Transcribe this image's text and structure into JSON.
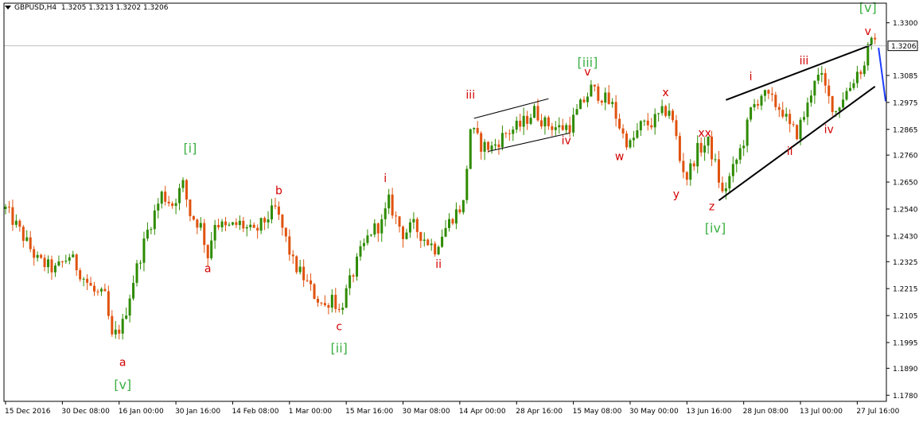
{
  "header": {
    "symbol": "GBPUSD,H4",
    "ohlc": "1.3205 1.3213 1.3202 1.3206"
  },
  "chart_data": {
    "type": "candlestick",
    "symbol": "GBPUSD",
    "timeframe": "H4",
    "ohlc_last": {
      "open": 1.3205,
      "high": 1.3213,
      "low": 1.3202,
      "close": 1.3206
    },
    "current_price_label": "1.3206",
    "current_price": 1.3206,
    "ylim": [
      1.1755,
      1.338
    ],
    "y_ticks": [
      "1.3300",
      "1.3085",
      "1.2975",
      "1.2865",
      "1.2760",
      "1.2650",
      "1.2540",
      "1.2430",
      "1.2325",
      "1.2215",
      "1.2105",
      "1.1995",
      "1.1890",
      "1.1780"
    ],
    "x_ticks": [
      "15 Dec 2016",
      "30 Dec 08:00",
      "16 Jan 00:00",
      "30 Jan 16:00",
      "14 Feb 08:00",
      "1 Mar 00:00",
      "15 Mar 16:00",
      "30 Mar 08:00",
      "14 Apr 00:00",
      "28 Apr 16:00",
      "15 May 08:00",
      "30 May 00:00",
      "13 Jun 16:00",
      "28 Jun 08:00",
      "13 Jul 00:00",
      "27 Jul 16:00"
    ],
    "x_tick_index": [
      0,
      16,
      32,
      48,
      64,
      80,
      96,
      112,
      128,
      144,
      160,
      176,
      192,
      208,
      224,
      240
    ],
    "bar_count": 246,
    "price_path": [
      [
        0,
        1.254
      ],
      [
        4,
        1.245
      ],
      [
        9,
        1.233
      ],
      [
        14,
        1.229
      ],
      [
        18,
        1.235
      ],
      [
        22,
        1.226
      ],
      [
        25,
        1.22
      ],
      [
        28,
        1.218
      ],
      [
        30,
        1.201
      ],
      [
        33,
        1.207
      ],
      [
        36,
        1.225
      ],
      [
        40,
        1.245
      ],
      [
        44,
        1.26
      ],
      [
        47,
        1.256
      ],
      [
        50,
        1.264
      ],
      [
        52,
        1.252
      ],
      [
        55,
        1.247
      ],
      [
        57,
        1.235
      ],
      [
        59,
        1.249
      ],
      [
        62,
        1.246
      ],
      [
        66,
        1.248
      ],
      [
        70,
        1.244
      ],
      [
        74,
        1.251
      ],
      [
        76,
        1.254
      ],
      [
        78,
        1.246
      ],
      [
        81,
        1.232
      ],
      [
        84,
        1.226
      ],
      [
        87,
        1.219
      ],
      [
        90,
        1.214
      ],
      [
        92,
        1.219
      ],
      [
        94,
        1.212
      ],
      [
        97,
        1.224
      ],
      [
        100,
        1.236
      ],
      [
        103,
        1.245
      ],
      [
        106,
        1.248
      ],
      [
        108,
        1.257
      ],
      [
        110,
        1.25
      ],
      [
        112,
        1.244
      ],
      [
        115,
        1.247
      ],
      [
        118,
        1.242
      ],
      [
        121,
        1.238
      ],
      [
        123,
        1.244
      ],
      [
        126,
        1.251
      ],
      [
        129,
        1.256
      ],
      [
        131,
        1.287
      ],
      [
        134,
        1.28
      ],
      [
        137,
        1.279
      ],
      [
        141,
        1.285
      ],
      [
        145,
        1.288
      ],
      [
        149,
        1.294
      ],
      [
        152,
        1.289
      ],
      [
        156,
        1.287
      ],
      [
        159,
        1.288
      ],
      [
        162,
        1.296
      ],
      [
        165,
        1.303
      ],
      [
        168,
        1.3
      ],
      [
        171,
        1.296
      ],
      [
        174,
        1.284
      ],
      [
        176,
        1.28
      ],
      [
        179,
        1.288
      ],
      [
        182,
        1.289
      ],
      [
        185,
        1.293
      ],
      [
        187,
        1.295
      ],
      [
        189,
        1.283
      ],
      [
        190,
        1.274
      ],
      [
        192,
        1.267
      ],
      [
        195,
        1.278
      ],
      [
        198,
        1.281
      ],
      [
        200,
        1.272
      ],
      [
        202,
        1.26
      ],
      [
        205,
        1.27
      ],
      [
        208,
        1.282
      ],
      [
        210,
        1.294
      ],
      [
        213,
        1.301
      ],
      [
        216,
        1.298
      ],
      [
        219,
        1.294
      ],
      [
        221,
        1.287
      ],
      [
        223,
        1.285
      ],
      [
        226,
        1.296
      ],
      [
        228,
        1.308
      ],
      [
        230,
        1.307
      ],
      [
        232,
        1.299
      ],
      [
        234,
        1.294
      ],
      [
        236,
        1.3
      ],
      [
        238,
        1.304
      ],
      [
        240,
        1.31
      ],
      [
        242,
        1.312
      ],
      [
        243,
        1.3225
      ],
      [
        245,
        1.3206
      ]
    ],
    "wave_labels": [
      {
        "text": "[v]",
        "bar": 33,
        "price": 1.1805,
        "color": "#3cb043"
      },
      {
        "text": "a",
        "bar": 33,
        "price": 1.19,
        "color": "#d40000"
      },
      {
        "text": "[i]",
        "bar": 52,
        "price": 1.277,
        "color": "#3cb043"
      },
      {
        "text": "a",
        "bar": 57,
        "price": 1.2282,
        "color": "#d40000"
      },
      {
        "text": "b",
        "bar": 77,
        "price": 1.26,
        "color": "#d40000"
      },
      {
        "text": "c",
        "bar": 94,
        "price": 1.2045,
        "color": "#d40000"
      },
      {
        "text": "[ii]",
        "bar": 94,
        "price": 1.1955,
        "color": "#3cb043"
      },
      {
        "text": "i",
        "bar": 107,
        "price": 1.265,
        "color": "#d40000"
      },
      {
        "text": "ii",
        "bar": 122,
        "price": 1.23,
        "color": "#d40000"
      },
      {
        "text": "iii",
        "bar": 131,
        "price": 1.299,
        "color": "#d40000"
      },
      {
        "text": "iv",
        "bar": 158,
        "price": 1.2805,
        "color": "#d40000"
      },
      {
        "text": "[iii]",
        "bar": 164,
        "price": 1.312,
        "color": "#3cb043"
      },
      {
        "text": "v",
        "bar": 164,
        "price": 1.3085,
        "color": "#d40000"
      },
      {
        "text": "w",
        "bar": 173,
        "price": 1.274,
        "color": "#d40000"
      },
      {
        "text": "x",
        "bar": 186,
        "price": 1.3,
        "color": "#d40000"
      },
      {
        "text": "y",
        "bar": 189,
        "price": 1.2585,
        "color": "#d40000"
      },
      {
        "text": "xx",
        "bar": 197,
        "price": 1.2835,
        "color": "#d40000"
      },
      {
        "text": "z",
        "bar": 199,
        "price": 1.2535,
        "color": "#d40000"
      },
      {
        "text": "[iv]",
        "bar": 200,
        "price": 1.2445,
        "color": "#3cb043"
      },
      {
        "text": "i",
        "bar": 210,
        "price": 1.3065,
        "color": "#d40000"
      },
      {
        "text": "ii",
        "bar": 221,
        "price": 1.276,
        "color": "#d40000"
      },
      {
        "text": "iii",
        "bar": 225,
        "price": 1.313,
        "color": "#d40000"
      },
      {
        "text": "iv",
        "bar": 232,
        "price": 1.285,
        "color": "#d40000"
      },
      {
        "text": "[v]",
        "bar": 243,
        "price": 1.3345,
        "color": "#3cb043"
      },
      {
        "text": "v",
        "bar": 243,
        "price": 1.325,
        "color": "#d40000"
      }
    ],
    "trend_lines": [
      {
        "from": [
          132,
          1.291
        ],
        "to": [
          153,
          1.299
        ],
        "color": "#000000",
        "width": 1
      },
      {
        "from": [
          136,
          1.2775
        ],
        "to": [
          159,
          1.285
        ],
        "color": "#000000",
        "width": 1
      },
      {
        "from": [
          203,
          1.2985
        ],
        "to": [
          244,
          1.321
        ],
        "color": "#000000",
        "width": 2
      },
      {
        "from": [
          201,
          1.2575
        ],
        "to": [
          245,
          1.304
        ],
        "color": "#000000",
        "width": 2
      },
      {
        "from": [
          246,
          1.3198
        ],
        "to": [
          248,
          1.298
        ],
        "color": "#1c3cff",
        "width": 2
      }
    ],
    "colors": {
      "up": "#2e8b00",
      "down": "#e0520e",
      "background": "#ffffff",
      "grid": "none",
      "price_line": "#c0c0c0",
      "axis": "#000000"
    },
    "grid": false
  }
}
